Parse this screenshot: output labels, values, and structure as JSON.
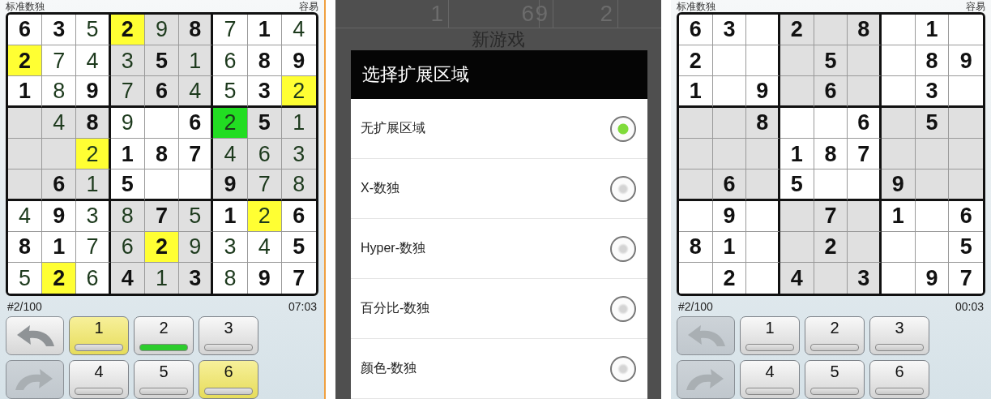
{
  "screens": [
    {
      "kind": "game",
      "title": "标准数独",
      "difficulty": "容易",
      "rows": [
        [
          {
            "v": "6",
            "given": true
          },
          {
            "v": "3",
            "given": true
          },
          {
            "v": "5",
            "given": false
          },
          {
            "v": "2",
            "given": true,
            "color": "#ffff33"
          },
          {
            "v": "9",
            "given": false
          },
          {
            "v": "8",
            "given": true
          },
          {
            "v": "7",
            "given": false
          },
          {
            "v": "1",
            "given": true
          },
          {
            "v": "4",
            "given": false
          }
        ],
        [
          {
            "v": "2",
            "given": true,
            "color": "#ffff33"
          },
          {
            "v": "7",
            "given": false
          },
          {
            "v": "4",
            "given": false
          },
          {
            "v": "3",
            "given": false
          },
          {
            "v": "5",
            "given": true
          },
          {
            "v": "1",
            "given": false
          },
          {
            "v": "6",
            "given": false
          },
          {
            "v": "8",
            "given": true
          },
          {
            "v": "9",
            "given": true
          }
        ],
        [
          {
            "v": "1",
            "given": true
          },
          {
            "v": "8",
            "given": false
          },
          {
            "v": "9",
            "given": true
          },
          {
            "v": "7",
            "given": false
          },
          {
            "v": "6",
            "given": true
          },
          {
            "v": "4",
            "given": false
          },
          {
            "v": "5",
            "given": false
          },
          {
            "v": "3",
            "given": true
          },
          {
            "v": "2",
            "given": false,
            "color": "#ffff33"
          }
        ],
        [
          {},
          {
            "v": "4",
            "given": false
          },
          {
            "v": "8",
            "given": true
          },
          {
            "v": "9",
            "given": false
          },
          {},
          {
            "v": "6",
            "given": true
          },
          {
            "v": "2",
            "given": false,
            "color": "#22dd22"
          },
          {
            "v": "5",
            "given": true
          },
          {
            "v": "1",
            "given": false
          }
        ],
        [
          {},
          {},
          {
            "v": "2",
            "given": false,
            "color": "#ffff33"
          },
          {
            "v": "1",
            "given": true
          },
          {
            "v": "8",
            "given": true
          },
          {
            "v": "7",
            "given": true
          },
          {
            "v": "4",
            "given": false
          },
          {
            "v": "6",
            "given": false
          },
          {
            "v": "3",
            "given": false
          }
        ],
        [
          {},
          {
            "v": "6",
            "given": true
          },
          {
            "v": "1",
            "given": false
          },
          {
            "v": "5",
            "given": true
          },
          {},
          {},
          {
            "v": "9",
            "given": true
          },
          {
            "v": "7",
            "given": false
          },
          {
            "v": "8",
            "given": false
          }
        ],
        [
          {
            "v": "4",
            "given": false
          },
          {
            "v": "9",
            "given": true
          },
          {
            "v": "3",
            "given": false
          },
          {
            "v": "8",
            "given": false
          },
          {
            "v": "7",
            "given": true
          },
          {
            "v": "5",
            "given": false
          },
          {
            "v": "1",
            "given": true
          },
          {
            "v": "2",
            "given": false,
            "color": "#ffff33"
          },
          {
            "v": "6",
            "given": true
          }
        ],
        [
          {
            "v": "8",
            "given": true
          },
          {
            "v": "1",
            "given": true
          },
          {
            "v": "7",
            "given": false
          },
          {
            "v": "6",
            "given": false
          },
          {
            "v": "2",
            "given": true,
            "color": "#ffff33"
          },
          {
            "v": "9",
            "given": false
          },
          {
            "v": "3",
            "given": false
          },
          {
            "v": "4",
            "given": false
          },
          {
            "v": "5",
            "given": true
          }
        ],
        [
          {
            "v": "5",
            "given": false
          },
          {
            "v": "2",
            "given": true,
            "color": "#ffff33"
          },
          {
            "v": "6",
            "given": false
          },
          {
            "v": "4",
            "given": true
          },
          {
            "v": "1",
            "given": false
          },
          {
            "v": "3",
            "given": true
          },
          {
            "v": "8",
            "given": false
          },
          {
            "v": "9",
            "given": true
          },
          {
            "v": "7",
            "given": true
          }
        ]
      ],
      "puzzle_number": "#2/100",
      "timer": "07:03",
      "undo": {
        "disabled": false
      },
      "redo": {
        "disabled": true
      },
      "keys": [
        {
          "label": "1",
          "selected": true,
          "done": false
        },
        {
          "label": "2",
          "selected": false,
          "done": true
        },
        {
          "label": "3",
          "selected": false,
          "done": false
        },
        {
          "label": "4",
          "selected": false,
          "done": false
        },
        {
          "label": "5",
          "selected": false,
          "done": false
        },
        {
          "label": "6",
          "selected": true,
          "done": false
        }
      ]
    },
    {
      "kind": "dialog",
      "background_digits": [
        "1",
        "6",
        "9",
        "2"
      ],
      "background_title": "新游戏",
      "dialog": {
        "title": "选择扩展区域",
        "options": [
          {
            "label": "无扩展区域",
            "selected": true
          },
          {
            "label": "X-数独",
            "selected": false
          },
          {
            "label": "Hyper-数独",
            "selected": false
          },
          {
            "label": "百分比-数独",
            "selected": false
          },
          {
            "label": "颜色-数独",
            "selected": false
          }
        ]
      }
    },
    {
      "kind": "game",
      "title": "标准数独",
      "difficulty": "容易",
      "rows": [
        [
          {
            "v": "6",
            "given": true
          },
          {
            "v": "3",
            "given": true
          },
          {},
          {
            "v": "2",
            "given": true
          },
          {},
          {
            "v": "8",
            "given": true
          },
          {},
          {
            "v": "1",
            "given": true
          },
          {}
        ],
        [
          {
            "v": "2",
            "given": true
          },
          {},
          {},
          {},
          {
            "v": "5",
            "given": true
          },
          {},
          {},
          {
            "v": "8",
            "given": true
          },
          {
            "v": "9",
            "given": true
          }
        ],
        [
          {
            "v": "1",
            "given": true
          },
          {},
          {
            "v": "9",
            "given": true
          },
          {},
          {
            "v": "6",
            "given": true
          },
          {},
          {},
          {
            "v": "3",
            "given": true
          },
          {}
        ],
        [
          {},
          {},
          {
            "v": "8",
            "given": true
          },
          {},
          {},
          {
            "v": "6",
            "given": true
          },
          {},
          {
            "v": "5",
            "given": true
          },
          {}
        ],
        [
          {},
          {},
          {},
          {
            "v": "1",
            "given": true
          },
          {
            "v": "8",
            "given": true
          },
          {
            "v": "7",
            "given": true
          },
          {},
          {},
          {}
        ],
        [
          {},
          {
            "v": "6",
            "given": true
          },
          {},
          {
            "v": "5",
            "given": true
          },
          {},
          {},
          {
            "v": "9",
            "given": true
          },
          {},
          {}
        ],
        [
          {},
          {
            "v": "9",
            "given": true
          },
          {},
          {},
          {
            "v": "7",
            "given": true
          },
          {},
          {
            "v": "1",
            "given": true
          },
          {},
          {
            "v": "6",
            "given": true
          }
        ],
        [
          {
            "v": "8",
            "given": true
          },
          {
            "v": "1",
            "given": true
          },
          {},
          {},
          {
            "v": "2",
            "given": true
          },
          {},
          {},
          {},
          {
            "v": "5",
            "given": true
          }
        ],
        [
          {},
          {
            "v": "2",
            "given": true
          },
          {},
          {
            "v": "4",
            "given": true
          },
          {},
          {
            "v": "3",
            "given": true
          },
          {},
          {
            "v": "9",
            "given": true
          },
          {
            "v": "7",
            "given": true
          }
        ]
      ],
      "puzzle_number": "#2/100",
      "timer": "00:03",
      "undo": {
        "disabled": true
      },
      "redo": {
        "disabled": true
      },
      "keys": [
        {
          "label": "1",
          "selected": false,
          "done": false
        },
        {
          "label": "2",
          "selected": false,
          "done": false
        },
        {
          "label": "3",
          "selected": false,
          "done": false
        },
        {
          "label": "4",
          "selected": false,
          "done": false
        },
        {
          "label": "5",
          "selected": false,
          "done": false
        },
        {
          "label": "6",
          "selected": false,
          "done": false
        }
      ]
    }
  ]
}
